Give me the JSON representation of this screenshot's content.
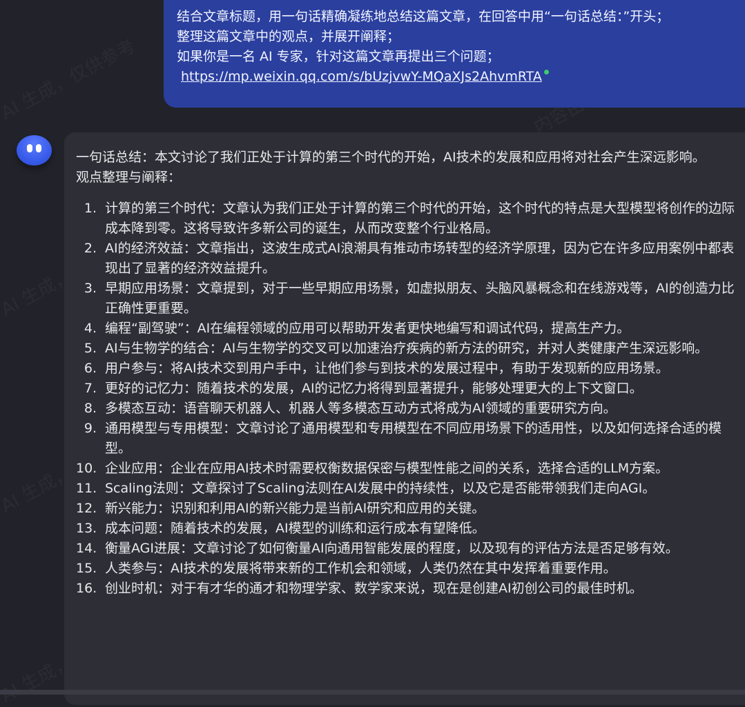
{
  "watermark_text": "AI 生成，仅供参考",
  "watermark_text_2": "内容由",
  "user_message": {
    "lines": [
      "结合文章标题，用一句话精确凝练地总结这篇文章，在回答中用“一句话总结：”开头；",
      "整理这篇文章中的观点，并展开阐释；",
      "如果你是一名 AI 专家，针对这篇文章再提出三个问题；"
    ],
    "link": "https://mp.weixin.qq.com/s/bUzjvwY-MQaXJs2AhvmRTA"
  },
  "bot_message": {
    "summary": "一句话总结：本文讨论了我们正处于计算的第三个时代的开始，AI技术的发展和应用将对社会产生深远影响。",
    "section_title": "观点整理与阐释：",
    "points": [
      {
        "num": "1.",
        "text": "计算的第三个时代：文章认为我们正处于计算的第三个时代的开始，这个时代的特点是大型模型将创作的边际成本降到零。这将导致许多新公司的诞生，从而改变整个行业格局。"
      },
      {
        "num": "2.",
        "text": "AI的经济效益：文章指出，这波生成式AI浪潮具有推动市场转型的经济学原理，因为它在许多应用案例中都表现出了显著的经济效益提升。"
      },
      {
        "num": "3.",
        "text": "早期应用场景：文章提到，对于一些早期应用场景，如虚拟朋友、头脑风暴概念和在线游戏等，AI的创造力比正确性更重要。"
      },
      {
        "num": "4.",
        "text": "编程“副驾驶”：AI在编程领域的应用可以帮助开发者更快地编写和调试代码，提高生产力。"
      },
      {
        "num": "5.",
        "text": "AI与生物学的结合：AI与生物学的交叉可以加速治疗疾病的新方法的研究，并对人类健康产生深远影响。"
      },
      {
        "num": "6.",
        "text": "用户参与：将AI技术交到用户手中，让他们参与到技术的发展过程中，有助于发现新的应用场景。"
      },
      {
        "num": "7.",
        "text": "更好的记忆力：随着技术的发展，AI的记忆力将得到显著提升，能够处理更大的上下文窗口。"
      },
      {
        "num": "8.",
        "text": "多模态互动：语音聊天机器人、机器人等多模态互动方式将成为AI领域的重要研究方向。"
      },
      {
        "num": "9.",
        "text": "通用模型与专用模型：文章讨论了通用模型和专用模型在不同应用场景下的适用性，以及如何选择合适的模型。"
      },
      {
        "num": "10.",
        "text": "企业应用：企业在应用AI技术时需要权衡数据保密与模型性能之间的关系，选择合适的LLM方案。"
      },
      {
        "num": "11.",
        "text": "Scaling法则：文章探讨了Scaling法则在AI发展中的持续性，以及它是否能带领我们走向AGI。"
      },
      {
        "num": "12.",
        "text": "新兴能力：识别和利用AI的新兴能力是当前AI研究和应用的关键。"
      },
      {
        "num": "13.",
        "text": "成本问题：随着技术的发展，AI模型的训练和运行成本有望降低。"
      },
      {
        "num": "14.",
        "text": "衡量AGI进展：文章讨论了如何衡量AI向通用智能发展的程度，以及现有的评估方法是否足够有效。"
      },
      {
        "num": "15.",
        "text": "人类参与：AI技术的发展将带来新的工作机会和领域，人类仍然在其中发挥着重要作用。"
      },
      {
        "num": "16.",
        "text": "创业时机：对于有才华的通才和物理学家、数学家来说，现在是创建AI初创公司的最佳时机。"
      }
    ]
  }
}
